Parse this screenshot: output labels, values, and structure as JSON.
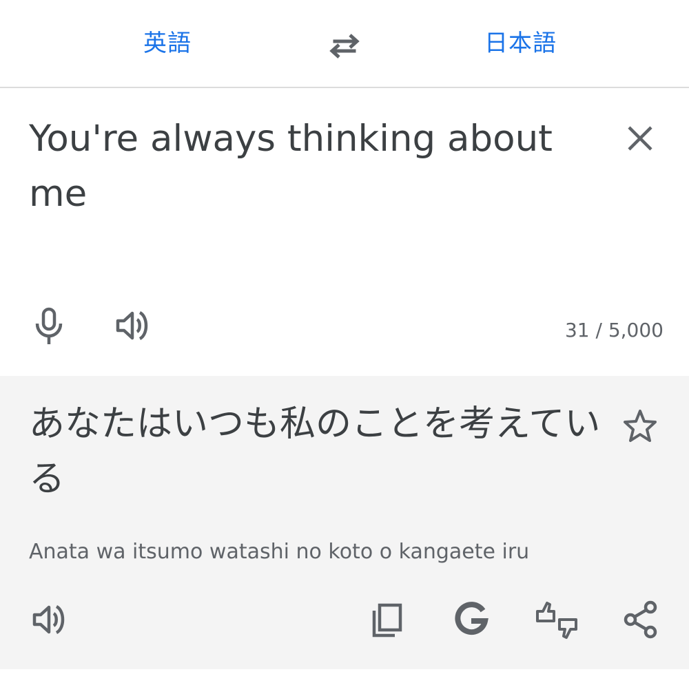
{
  "language_bar": {
    "source_language": "英語",
    "target_language": "日本語",
    "swap_icon": "swap-arrows-icon"
  },
  "source": {
    "text": "You're always thinking about me",
    "char_count": "31 / 5,000",
    "icons": [
      "close-icon",
      "microphone-icon",
      "volume-icon"
    ]
  },
  "result": {
    "translation": "あなたはいつも私のことを考えている",
    "romanization": "Anata wa itsumo watashi no koto o kangaete iru",
    "icons": [
      "star-icon",
      "volume-icon",
      "copy-icon",
      "google-g-icon",
      "feedback-icon",
      "share-icon"
    ]
  },
  "colors": {
    "accent": "#1a73e8",
    "icon": "#5f6368",
    "text": "#3c4043",
    "result_background": "#f4f4f4"
  }
}
